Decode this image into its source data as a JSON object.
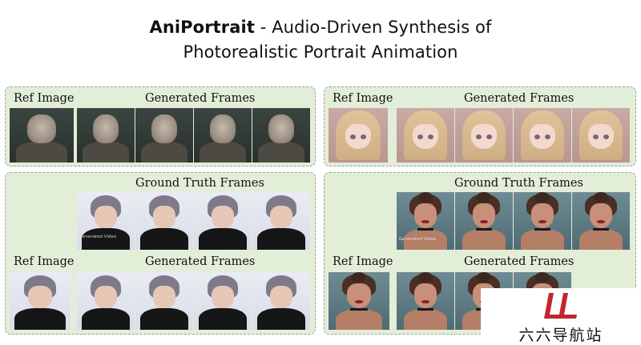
{
  "header": {
    "title_bold": "AniPortrait",
    "title_rest": " - Audio-Driven Synthesis of",
    "title_line2": "Photorealistic Portrait Animation"
  },
  "panels": {
    "top_left": {
      "ref_label": "Ref Image",
      "gen_label": "Generated Frames"
    },
    "top_right": {
      "ref_label": "Ref Image",
      "gen_label": "Generated Frames"
    },
    "bottom_left": {
      "gt_label": "Ground Truth Frames",
      "ref_label": "Ref Image",
      "gen_label": "Generated Frames",
      "watermark": "Generated Video"
    },
    "bottom_right": {
      "gt_label": "Ground Truth Frames",
      "ref_label": "Ref Image",
      "gen_label": "Generated Frames",
      "watermark": "Generated Video"
    }
  },
  "logo": {
    "text": "六六导航站",
    "accent_color": "#c0272d"
  },
  "colors": {
    "panel_bg": "#e3eed8",
    "panel_border": "#9aa59a"
  }
}
